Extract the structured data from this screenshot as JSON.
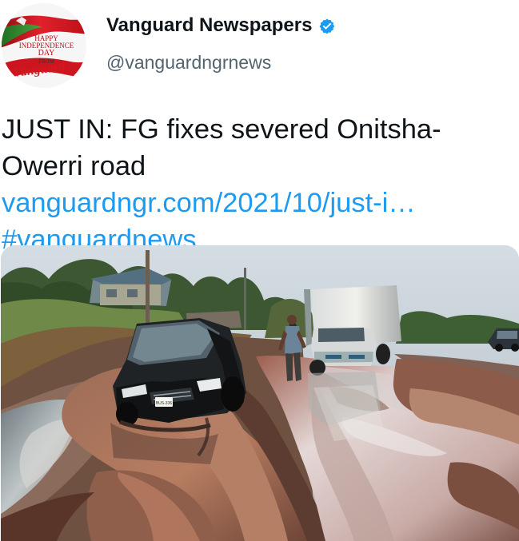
{
  "tweet": {
    "author": {
      "display_name": "Vanguard Newspapers",
      "handle": "@vanguardngrnews",
      "verified_icon": "verified-badge-icon"
    },
    "avatar": {
      "line1": "HAPPY",
      "line2": "INDEPENDENCE",
      "line3": "DAY",
      "line4": "FROM",
      "brand": "Vanguard"
    },
    "text": {
      "prefix": "JUST IN: FG fixes severed Onitsha-Owerri road ",
      "link": "vanguardngr.com/2021/10/just-i…",
      "separator": " ",
      "hashtag": "#vanguardnews"
    },
    "media": {
      "license_plate": "BUS-336"
    }
  },
  "colors": {
    "text": "#0f1419",
    "secondary_text": "#536471",
    "link": "#1d9bf0",
    "verified": "#1d9bf0",
    "avatar_red": "#d51820",
    "avatar_green": "#2d8a2f"
  }
}
